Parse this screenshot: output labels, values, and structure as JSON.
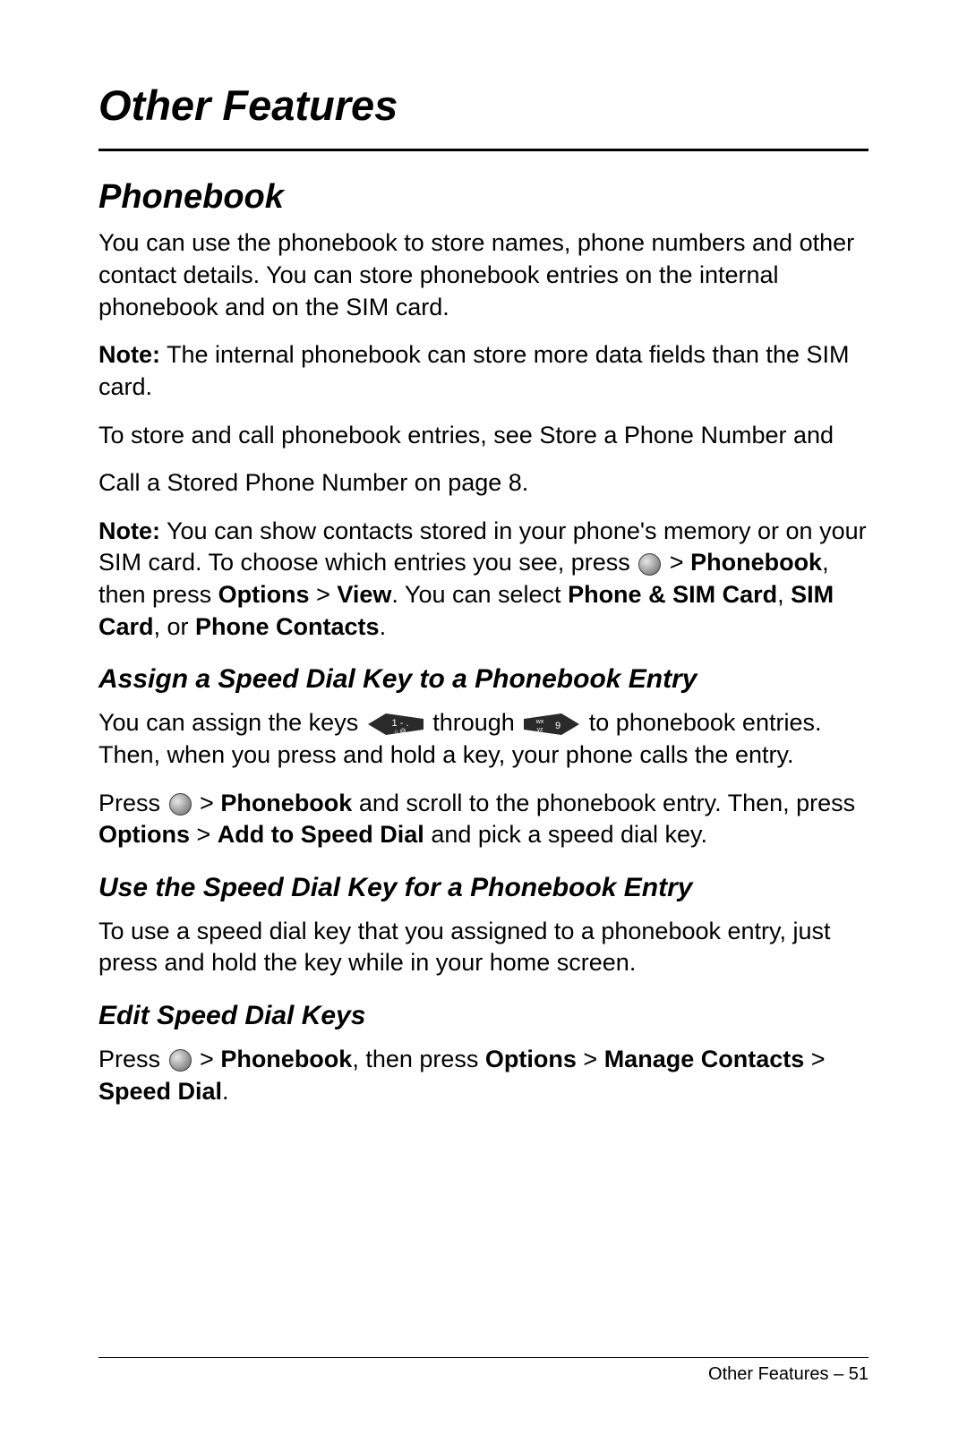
{
  "page_title": "Other Features",
  "section": {
    "heading": "Phonebook",
    "para1": "You can use the phonebook to store names, phone numbers and other contact details. You can store phonebook entries on the internal phonebook and on the SIM card.",
    "note1_label": "Note:",
    "note1_text": " The internal phonebook can store more data fields than the SIM card.",
    "para2": "To store and call phonebook entries, see Store a Phone Number and",
    "para3": "Call a Stored Phone Number on page 8.",
    "note2_label": "Note:",
    "note2_text1": " You can show contacts stored in your phone's memory or on your SIM card. To choose which entries you see, press ",
    "note2_text2": " > ",
    "note2_phonebook": "Phonebook",
    "note2_text3": ", then press ",
    "note2_options": "Options",
    "note2_text4": " > ",
    "note2_view": "View",
    "note2_text5": ". You can select ",
    "note2_opt1": "Phone & SIM Card",
    "note2_text6": ", ",
    "note2_opt2": "SIM Card",
    "note2_text7": ", or ",
    "note2_opt3": "Phone Contacts",
    "note2_text8": ".",
    "sub1_heading": "Assign a Speed Dial Key to a Phonebook Entry",
    "sub1_para1a": "You can assign the keys ",
    "sub1_para1b": " through ",
    "sub1_para1c": " to phonebook entries. Then, when you press and hold a key, your phone calls the entry.",
    "sub1_para2a": "Press ",
    "sub1_para2b": " > ",
    "sub1_para2_phonebook": "Phonebook",
    "sub1_para2c": " and scroll to the phonebook entry. Then, press ",
    "sub1_para2_options": "Options",
    "sub1_para2d": " > ",
    "sub1_para2_add": "Add to Speed Dial",
    "sub1_para2e": " and pick a speed dial key.",
    "sub2_heading": "Use the Speed Dial Key for a Phonebook Entry",
    "sub2_para1": "To use a speed dial key that you assigned to a phonebook entry, just press and hold the key while in your home screen.",
    "sub3_heading": "Edit Speed Dial Keys",
    "sub3_para1a": "Press ",
    "sub3_para1b": " > ",
    "sub3_para1_phonebook": "Phonebook",
    "sub3_para1c": ", then press ",
    "sub3_para1_options": "Options",
    "sub3_para1d": " > ",
    "sub3_para1_manage": "Manage Contacts",
    "sub3_para1e": " > ",
    "sub3_para1_speed": "Speed Dial",
    "sub3_para1f": "."
  },
  "footer": {
    "text": "Other Features – 51"
  },
  "key1_label": "1",
  "key1_sub": "⌂@",
  "key9_label": "9",
  "key9_sub": "wx yz"
}
